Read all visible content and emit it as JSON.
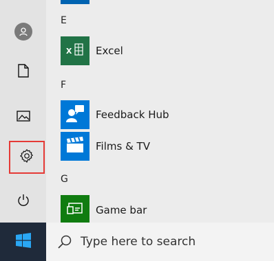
{
  "start_menu": {
    "groups": [
      {
        "letter": "E",
        "apps": [
          {
            "label": "Excel",
            "icon": "excel-icon",
            "color": "#217346"
          }
        ]
      },
      {
        "letter": "F",
        "apps": [
          {
            "label": "Feedback Hub",
            "icon": "feedback-hub-icon",
            "color": "#0078d7"
          },
          {
            "label": "Films & TV",
            "icon": "films-tv-icon",
            "color": "#0078d7"
          }
        ]
      },
      {
        "letter": "G",
        "apps": [
          {
            "label": "Game bar",
            "icon": "game-bar-icon",
            "color": "#107c10"
          }
        ]
      }
    ],
    "rail_icons": [
      "user-icon",
      "documents-icon",
      "pictures-icon",
      "settings-icon",
      "power-icon"
    ]
  },
  "taskbar": {
    "search_placeholder": "Type here to search",
    "start_icon": "windows-logo-icon",
    "accent": "#1f2a3a"
  }
}
